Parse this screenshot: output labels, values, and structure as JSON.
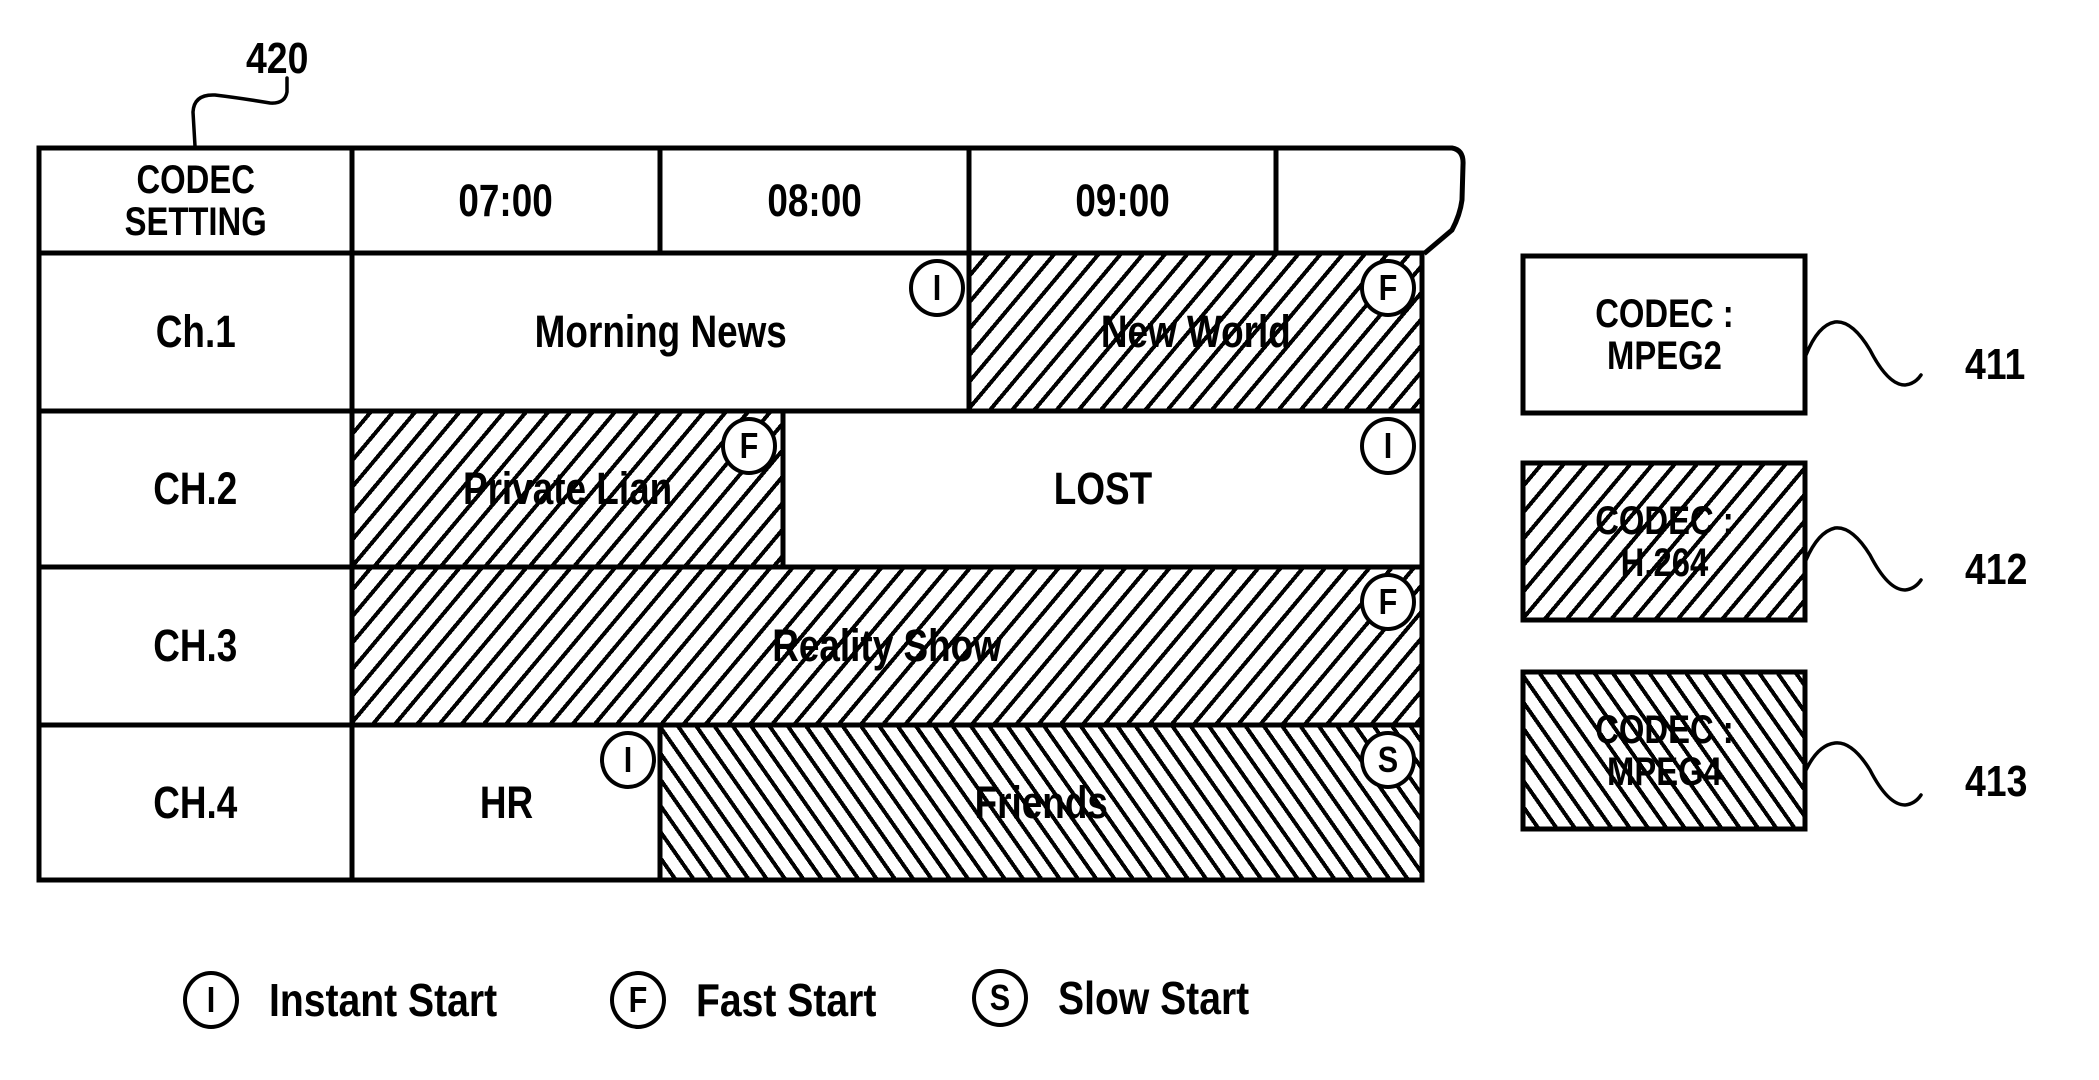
{
  "figure": {
    "reference_labels": {
      "grid": "420",
      "codec_mpeg2": "411",
      "codec_h264": "412",
      "codec_mpeg4": "413"
    }
  },
  "grid": {
    "corner_header": [
      "CODEC",
      "SETTING"
    ],
    "time_slots": [
      "07:00",
      "08:00",
      "09:00",
      ""
    ],
    "channels": [
      {
        "name": "Ch.1",
        "programs": [
          {
            "title": "Morning News",
            "codec": "MPEG2",
            "start_mode": "I"
          },
          {
            "title": "New World",
            "codec": "H.264",
            "start_mode": "F"
          }
        ]
      },
      {
        "name": "CH.2",
        "programs": [
          {
            "title": "Private Lian",
            "codec": "H.264",
            "start_mode": "F"
          },
          {
            "title": "LOST",
            "codec": "MPEG2",
            "start_mode": "I"
          }
        ]
      },
      {
        "name": "CH.3",
        "programs": [
          {
            "title": "Reality Show",
            "codec": "H.264",
            "start_mode": "F"
          }
        ]
      },
      {
        "name": "CH.4",
        "programs": [
          {
            "title": "HR",
            "codec": "MPEG2",
            "start_mode": "I"
          },
          {
            "title": "Friends",
            "codec": "MPEG4",
            "start_mode": "S"
          }
        ]
      }
    ]
  },
  "codec_legend": [
    {
      "line1": "CODEC :",
      "line2": "MPEG2",
      "pattern": "plain",
      "ref": "411"
    },
    {
      "line1": "CODEC :",
      "line2": "H.264",
      "pattern": "forward-hatch",
      "ref": "412"
    },
    {
      "line1": "CODEC :",
      "line2": "MPEG4",
      "pattern": "backward-hatch",
      "ref": "413"
    }
  ],
  "start_legend": [
    {
      "symbol": "I",
      "label": "Instant Start"
    },
    {
      "symbol": "F",
      "label": "Fast Start"
    },
    {
      "symbol": "S",
      "label": "Slow Start"
    }
  ]
}
